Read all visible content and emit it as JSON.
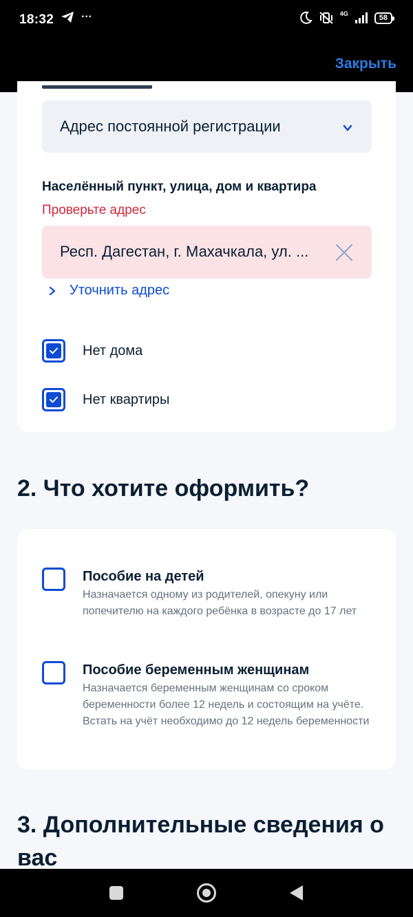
{
  "status_bar": {
    "time": "18:32",
    "more_indicator": "···",
    "network_type": "4G",
    "battery": "58",
    "icons": [
      "telegram-icon",
      "moon-icon",
      "vibrate-off-icon",
      "signal-icon",
      "battery-icon"
    ]
  },
  "top_bar": {
    "close_label": "Закрыть",
    "accent": "#2a7de1"
  },
  "address_section": {
    "address_type_value": "Адрес постоянной регистрации",
    "field_label": "Населённый пункт, улица, дом и квартира",
    "error_text": "Проверьте адрес",
    "address_value": "Респ. Дагестан, г. Махачкала, ул. ...",
    "refine_link": "Уточнить адрес",
    "checkboxes": [
      {
        "label": "Нет дома",
        "checked": true
      },
      {
        "label": "Нет квартиры",
        "checked": true
      }
    ]
  },
  "section2": {
    "title": "2. Что хотите оформить?",
    "options": [
      {
        "title": "Пособие на детей",
        "description": "Назначается одному из родителей, опекуну или попечителю на каждого ребёнка в возрасте до 17 лет",
        "checked": false
      },
      {
        "title": "Пособие беременным женщинам",
        "description": "Назначается беременным женщинам со сроком беременности более 12 недель и состоящим на учёте. Встать на учёт необходимо до 12 недель беременности",
        "checked": false
      }
    ]
  },
  "section3": {
    "title": "3. Дополнительные сведения о вас"
  },
  "colors": {
    "primary": "#0d4cd3",
    "error": "#d0283c",
    "error_bg": "#fbe3e5",
    "text": "#0b1f33",
    "muted": "#66727f"
  }
}
